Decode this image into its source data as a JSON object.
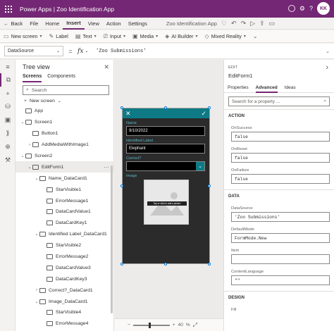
{
  "titlebar": {
    "app_title": "Power Apps  |  Zoo Identification App",
    "avatar_initials": "KK"
  },
  "menubar": {
    "back": "Back",
    "items": [
      "File",
      "Home",
      "Insert",
      "View",
      "Action",
      "Settings"
    ],
    "active": "Insert",
    "doc_title": "Zoo Identification App"
  },
  "ribbon": {
    "new_screen": "New screen",
    "label": "Label",
    "text": "Text",
    "input": "Input",
    "media": "Media",
    "ai_builder": "AI Builder",
    "mixed_reality": "Mixed Reality"
  },
  "formula": {
    "property": "DataSource",
    "eq": "=",
    "fx": "fx",
    "value": "'Zoo Submissions'"
  },
  "treeview": {
    "title": "Tree view",
    "tabs": [
      "Screens",
      "Components"
    ],
    "search_placeholder": "Search",
    "new_screen": "New screen",
    "rows": [
      {
        "label": "App",
        "indent": 0,
        "chev": ""
      },
      {
        "label": "Screen1",
        "indent": 0,
        "chev": "⌄"
      },
      {
        "label": "Button1",
        "indent": 1,
        "chev": ""
      },
      {
        "label": "AddMediaWithImage1",
        "indent": 1,
        "chev": "›"
      },
      {
        "label": "Screen2",
        "indent": 0,
        "chev": "⌄"
      },
      {
        "label": "EditForm1",
        "indent": 1,
        "chev": "⌄"
      },
      {
        "label": "Name_DataCard1",
        "indent": 2,
        "chev": "⌄"
      },
      {
        "label": "StarVisible1",
        "indent": 3,
        "chev": ""
      },
      {
        "label": "ErrorMessage1",
        "indent": 3,
        "chev": ""
      },
      {
        "label": "DataCardValue1",
        "indent": 3,
        "chev": ""
      },
      {
        "label": "DataCardKey1",
        "indent": 3,
        "chev": ""
      },
      {
        "label": "Identified Label_DataCard1",
        "indent": 2,
        "chev": "⌄"
      },
      {
        "label": "StarVisible2",
        "indent": 3,
        "chev": ""
      },
      {
        "label": "ErrorMessage2",
        "indent": 3,
        "chev": ""
      },
      {
        "label": "DataCardValue3",
        "indent": 3,
        "chev": ""
      },
      {
        "label": "DataCardKey3",
        "indent": 3,
        "chev": ""
      },
      {
        "label": "Correct?_DataCard1",
        "indent": 2,
        "chev": "›"
      },
      {
        "label": "Image_DataCard1",
        "indent": 2,
        "chev": "⌄"
      },
      {
        "label": "StarVisible4",
        "indent": 3,
        "chev": ""
      },
      {
        "label": "ErrorMessage4",
        "indent": 3,
        "chev": ""
      }
    ]
  },
  "canvas": {
    "fields": {
      "name_label": "Name",
      "name_value": "9/10/2022",
      "identified_label": "Identified Label",
      "identified_value": "Elephant",
      "correct_label": "Correct?",
      "image_label": "Image",
      "tap_text": "Tap or click to add a picture"
    },
    "zoom": {
      "minus": "−",
      "plus": "+",
      "percent": "40",
      "unit": "%"
    }
  },
  "properties": {
    "type": "EDIT",
    "name": "EditForm1",
    "tabs": [
      "Properties",
      "Advanced",
      "Ideas"
    ],
    "active_tab": "Advanced",
    "search_placeholder": "Search for a property ...",
    "sections": {
      "action": "ACTION",
      "data": "DATA",
      "design": "DESIGN"
    },
    "action_props": [
      {
        "label": "OnSuccess",
        "value": "false"
      },
      {
        "label": "OnReset",
        "value": "false"
      },
      {
        "label": "OnFailure",
        "value": "false"
      }
    ],
    "data_props": [
      {
        "label": "DataSource",
        "value": "'Zoo Submissions'"
      },
      {
        "label": "DefaultMode",
        "value": "FormMode.New"
      },
      {
        "label": "Item",
        "value": ""
      },
      {
        "label": "ContentLanguage",
        "value": "\"\""
      }
    ],
    "design_first_label": "Fill"
  },
  "colors": {
    "brand": "#742774",
    "form_accent": "#0d7a85"
  }
}
